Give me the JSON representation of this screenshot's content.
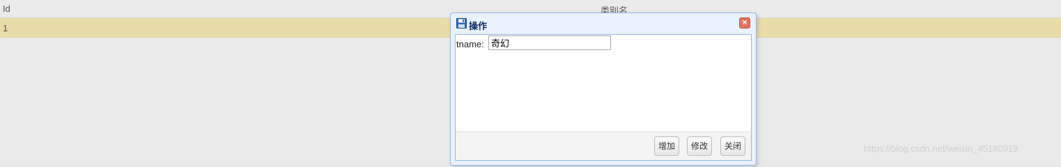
{
  "grid": {
    "columns": [
      "Id",
      "类别名"
    ],
    "rows": [
      [
        "1",
        ""
      ]
    ],
    "selected_row_color": "#ebdba8"
  },
  "dialog": {
    "title": "操作",
    "icon": "save-icon",
    "close_icon": "close-icon",
    "close_glyph": "×",
    "field_label": "tname:",
    "field_value": "奇幻",
    "buttons": {
      "add": "增加",
      "edit": "修改",
      "close": "关闭"
    }
  },
  "watermark": "https://blog.csdn.net/weixin_45180919"
}
